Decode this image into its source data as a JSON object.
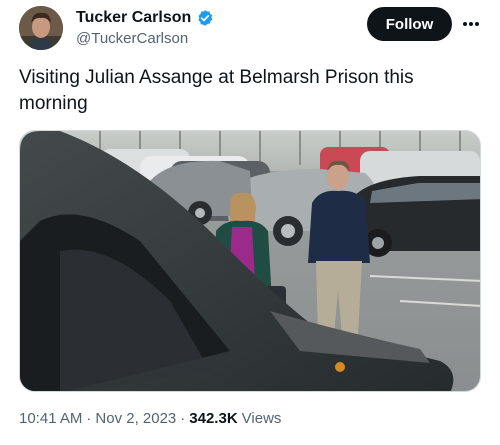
{
  "author": {
    "display_name": "Tucker Carlson",
    "handle": "@TuckerCarlson",
    "verified": true,
    "avatar_icon": "profile-photo"
  },
  "actions": {
    "follow_label": "Follow",
    "more_icon": "more-horizontal-icon"
  },
  "tweet": {
    "text": "Visiting Julian Assange at Belmarsh Prison this morning"
  },
  "meta": {
    "time": "10:41 AM",
    "separator": "·",
    "date": "Nov 2, 2023",
    "separator2": "·",
    "views_count": "342.3K",
    "views_label": "Views"
  },
  "colors": {
    "verified_blue": "#1d9bf0",
    "follow_bg": "#0f1419",
    "secondary_text": "#536471"
  }
}
